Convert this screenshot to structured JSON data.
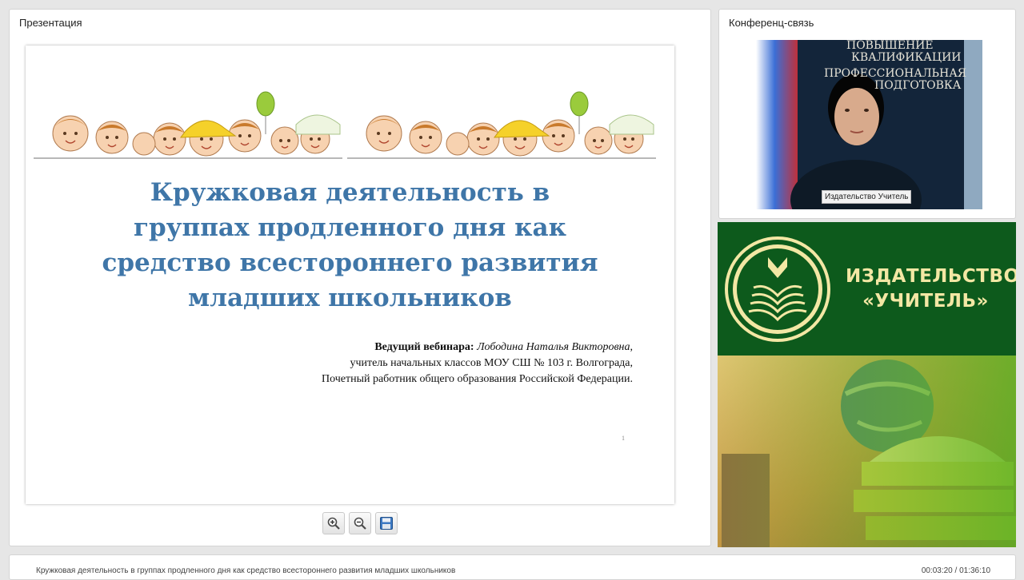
{
  "presentation_panel": {
    "title": "Презентация",
    "slide": {
      "title_lines": [
        "Кружковая деятельность в",
        "группах продленного дня как",
        "средство всестороннего развития",
        "младших школьников"
      ],
      "presenter_label": "Ведущий вебинара:",
      "presenter_name": "Лободина Наталья Викторовна",
      "presenter_line2": "учитель начальных классов МОУ СШ № 103 г. Волгограда,",
      "presenter_line3": "Почетный работник общего образования Российской Федерации.",
      "page_number": "1"
    },
    "toolbar": [
      {
        "name": "zoom-in-icon"
      },
      {
        "name": "zoom-out-icon"
      },
      {
        "name": "save-icon"
      }
    ]
  },
  "conference_panel": {
    "title": "Конференц-связь",
    "video_label": "Издательство Учитель",
    "backdrop_lines": [
      "ПОВЫШЕНИЕ",
      "КВАЛИФИКАЦИИ",
      "ПРОФЕССИОНАЛЬНАЯ",
      "ПОДГОТОВКА"
    ]
  },
  "brand": {
    "line1": "ИЗДАТЕЛЬСТВО",
    "line2": "«УЧИТЕЛЬ»"
  },
  "footer": {
    "title": "Кружковая деятельность в группах продленного дня как средство всестороннего развития младших школьников",
    "time": "00:03:20 / 01:36:10"
  },
  "colors": {
    "slide_title": "#3f76a8",
    "brand_green": "#0d5a1c",
    "brand_text": "#f3e7a4"
  }
}
